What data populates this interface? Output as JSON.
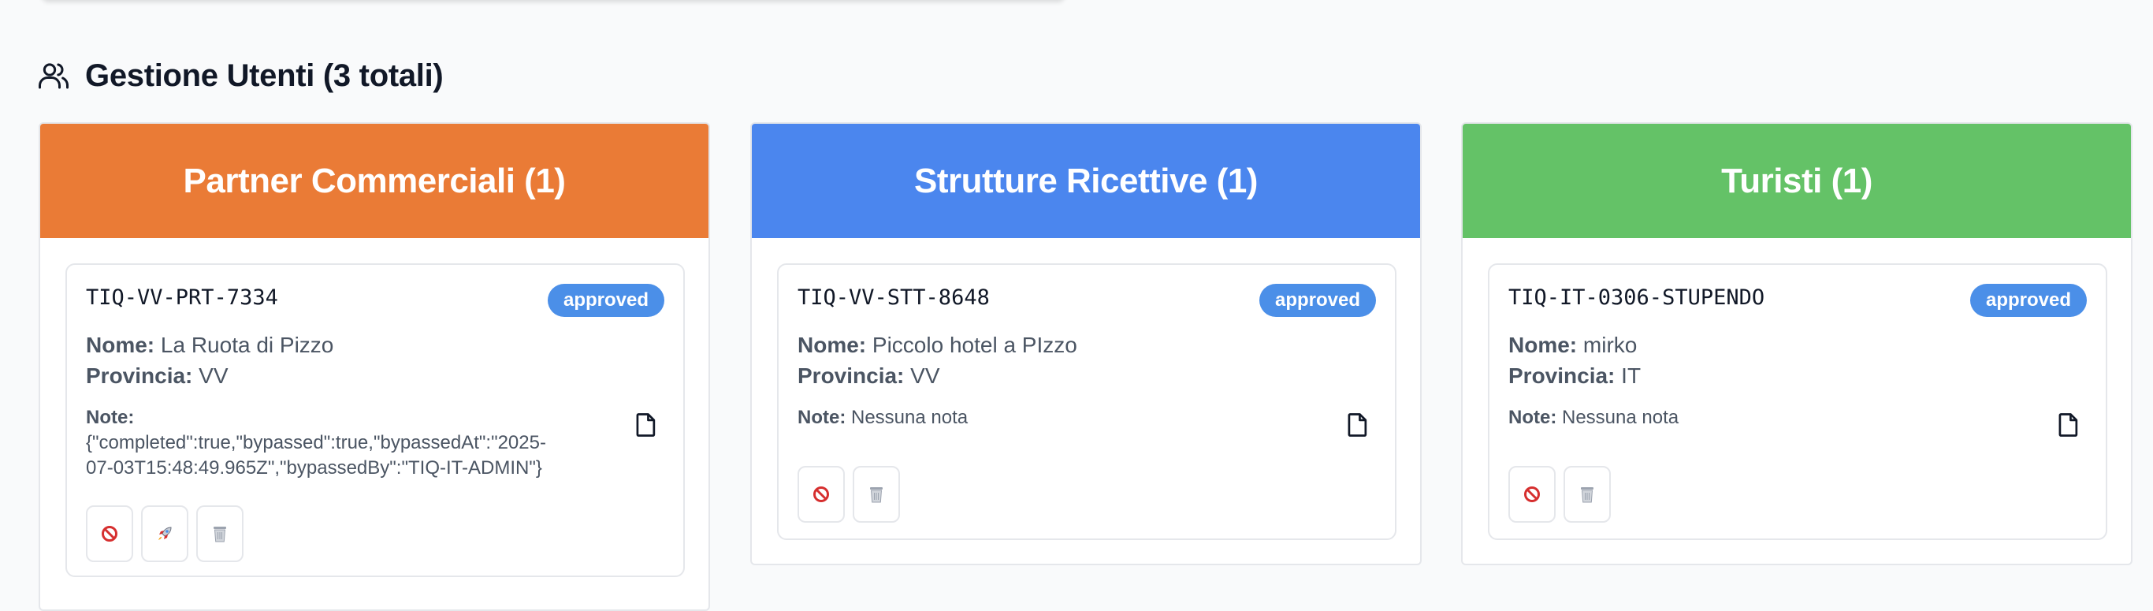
{
  "section": {
    "title": "Gestione Utenti (3 totali)",
    "icon": "users-icon"
  },
  "colors": {
    "partner": "#ea7b36",
    "strutture": "#4b86ee",
    "turisti": "#64c267",
    "badge_approved": "#4b8fe8"
  },
  "columns": [
    {
      "title": "Partner Commerciali (1)",
      "user": {
        "id": "TIQ-VV-PRT-7334",
        "status": "approved",
        "name_label": "Nome:",
        "name": "La Ruota di Pizzo",
        "province_label": "Provincia:",
        "province": "VV",
        "note_label": "Note:",
        "note_line1": "{\"completed\":true,\"bypassed\":true,\"bypassedAt\":\"2025-",
        "note_line2": "07-03T15:48:49.965Z\",\"bypassedBy\":\"TIQ-IT-ADMIN\"}",
        "actions": [
          "block-icon",
          "rocket-icon",
          "trash-icon"
        ]
      }
    },
    {
      "title": "Strutture Ricettive (1)",
      "user": {
        "id": "TIQ-VV-STT-8648",
        "status": "approved",
        "name_label": "Nome:",
        "name": "Piccolo hotel a PIzzo",
        "province_label": "Provincia:",
        "province": "VV",
        "note_label": "Note:",
        "note": "Nessuna nota",
        "actions": [
          "block-icon",
          "trash-icon"
        ]
      }
    },
    {
      "title": "Turisti (1)",
      "user": {
        "id": "TIQ-IT-0306-STUPENDO",
        "status": "approved",
        "name_label": "Nome:",
        "name": "mirko",
        "province_label": "Provincia:",
        "province": "IT",
        "note_label": "Note:",
        "note": "Nessuna nota",
        "actions": [
          "block-icon",
          "trash-icon"
        ]
      }
    }
  ]
}
